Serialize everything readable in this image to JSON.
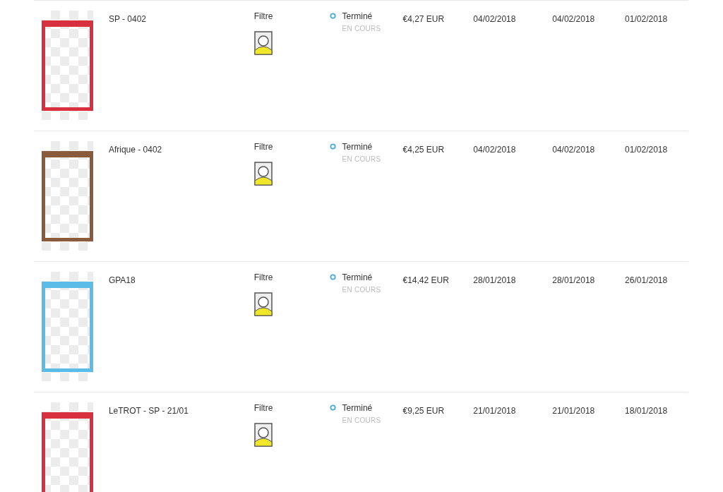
{
  "rows": [
    {
      "name": "SP - 0402",
      "type": "Filtre",
      "status": "Terminé",
      "substatus": "EN COURS",
      "price": "€4,27 EUR",
      "date_1": "04/02/2018",
      "date_2": "04/02/2018",
      "date_3": "01/02/2018",
      "color": "#d9303f"
    },
    {
      "name": "Afrique - 0402",
      "type": "Filtre",
      "status": "Terminé",
      "substatus": "EN COURS",
      "price": "€4,25 EUR",
      "date_1": "04/02/2018",
      "date_2": "04/02/2018",
      "date_3": "01/02/2018",
      "color": "#8a5a3c"
    },
    {
      "name": "GPA18",
      "type": "Filtre",
      "status": "Terminé",
      "substatus": "EN COURS",
      "price": "€14,42 EUR",
      "date_1": "28/01/2018",
      "date_2": "28/01/2018",
      "date_3": "26/01/2018",
      "color": "#5bbde6"
    },
    {
      "name": "LeTROT - SP - 21/01",
      "type": "Filtre",
      "status": "Terminé",
      "substatus": "EN COURS",
      "price": "€9,25 EUR",
      "date_1": "21/01/2018",
      "date_2": "21/01/2018",
      "date_3": "18/01/2018",
      "color": "#d9303f"
    }
  ]
}
